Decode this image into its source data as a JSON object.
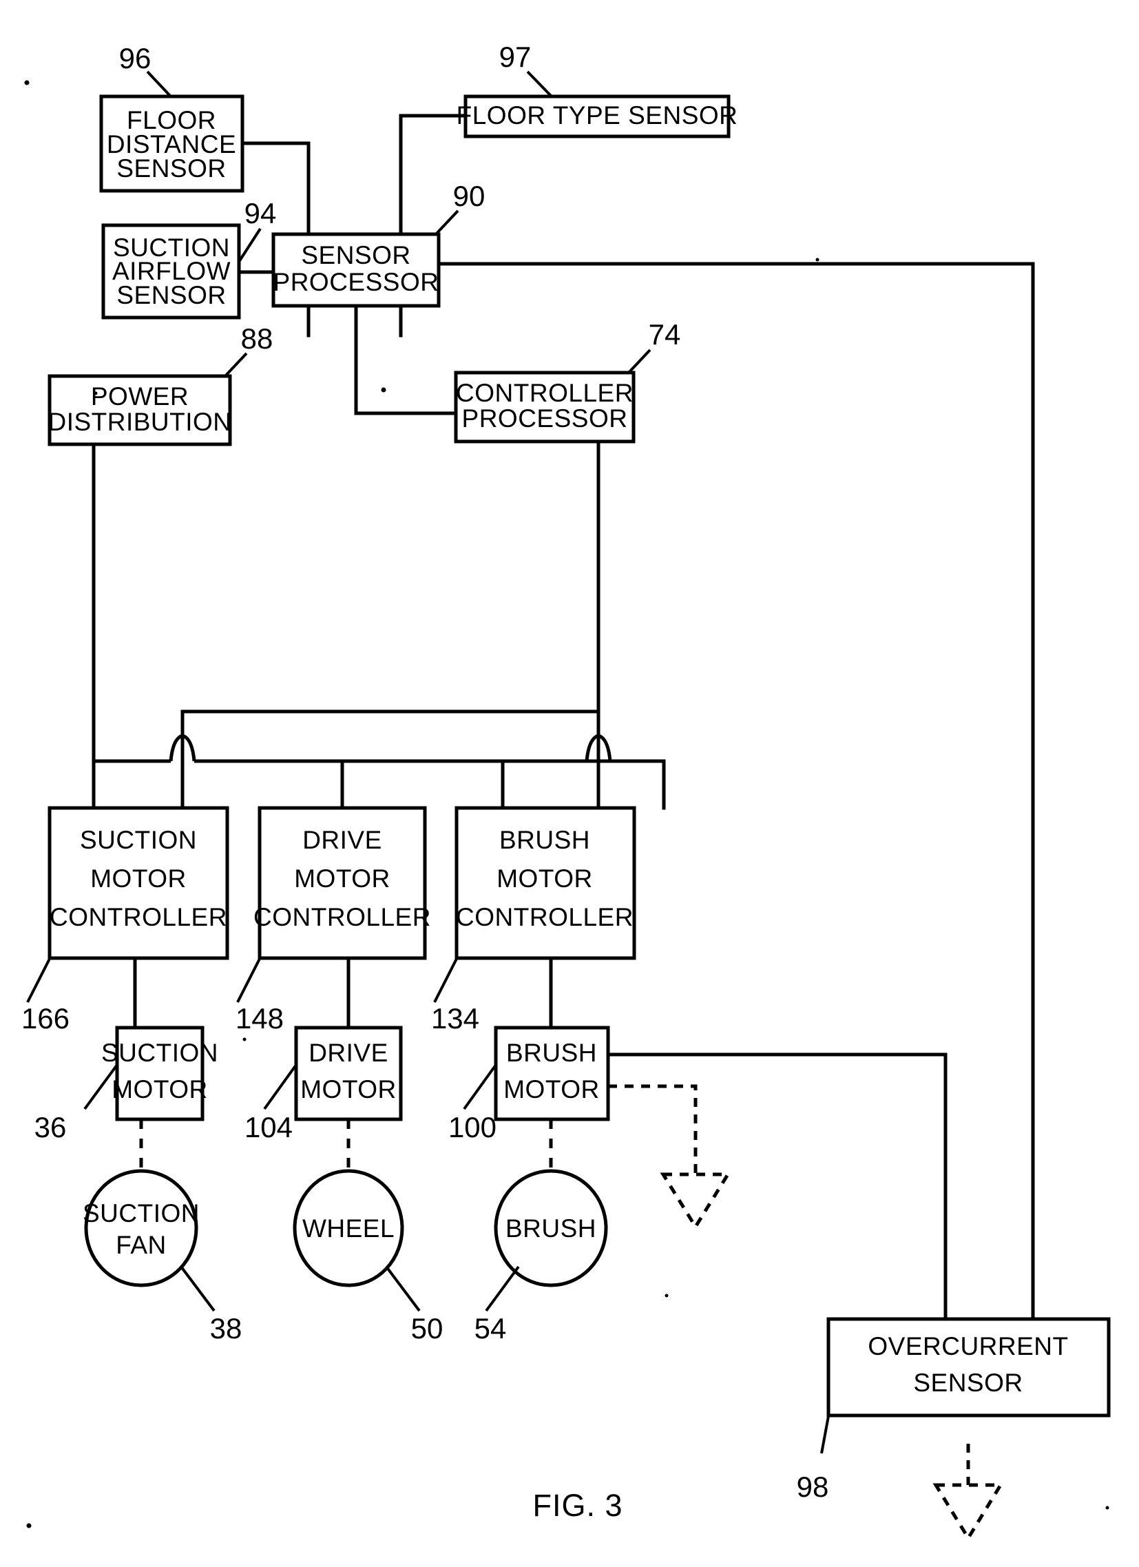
{
  "figure": {
    "caption": "FIG. 3",
    "title": "Vacuum cleaner control block diagram"
  },
  "blocks": {
    "floor_distance_sensor": {
      "lines": [
        "FLOOR",
        "DISTANCE",
        "SENSOR"
      ],
      "ref": "96"
    },
    "floor_type_sensor": {
      "lines": [
        "FLOOR TYPE SENSOR"
      ],
      "ref": "97"
    },
    "suction_airflow_sensor": {
      "lines": [
        "SUCTION",
        "AIRFLOW",
        "SENSOR"
      ],
      "ref": "94"
    },
    "sensor_processor": {
      "lines": [
        "SENSOR",
        "PROCESSOR"
      ],
      "ref": "90"
    },
    "controller_processor": {
      "lines": [
        "CONTROLLER",
        "PROCESSOR"
      ],
      "ref": "74"
    },
    "power_distribution": {
      "lines": [
        "POWER",
        "DISTRIBUTION"
      ],
      "ref": "88"
    },
    "suction_motor_controller": {
      "lines": [
        "SUCTION",
        "MOTOR",
        "CONTROLLER"
      ],
      "ref": "166"
    },
    "drive_motor_controller": {
      "lines": [
        "DRIVE",
        "MOTOR",
        "CONTROLLER"
      ],
      "ref": "148"
    },
    "brush_motor_controller": {
      "lines": [
        "BRUSH",
        "MOTOR",
        "CONTROLLER"
      ],
      "ref": "134"
    },
    "suction_motor": {
      "lines": [
        "SUCTION",
        "MOTOR"
      ],
      "ref": "36"
    },
    "drive_motor": {
      "lines": [
        "DRIVE",
        "MOTOR"
      ],
      "ref": "104"
    },
    "brush_motor": {
      "lines": [
        "BRUSH",
        "MOTOR"
      ],
      "ref": "100"
    },
    "suction_fan": {
      "lines": [
        "SUCTION",
        "FAN"
      ],
      "ref": "38"
    },
    "wheel": {
      "lines": [
        "WHEEL"
      ],
      "ref": "50"
    },
    "brush": {
      "lines": [
        "BRUSH"
      ],
      "ref": "54"
    },
    "overcurrent_sensor": {
      "lines": [
        "OVERCURRENT",
        "SENSOR"
      ],
      "ref": "98"
    }
  },
  "colors": {
    "ink": "#000000",
    "paper": "#ffffff"
  }
}
